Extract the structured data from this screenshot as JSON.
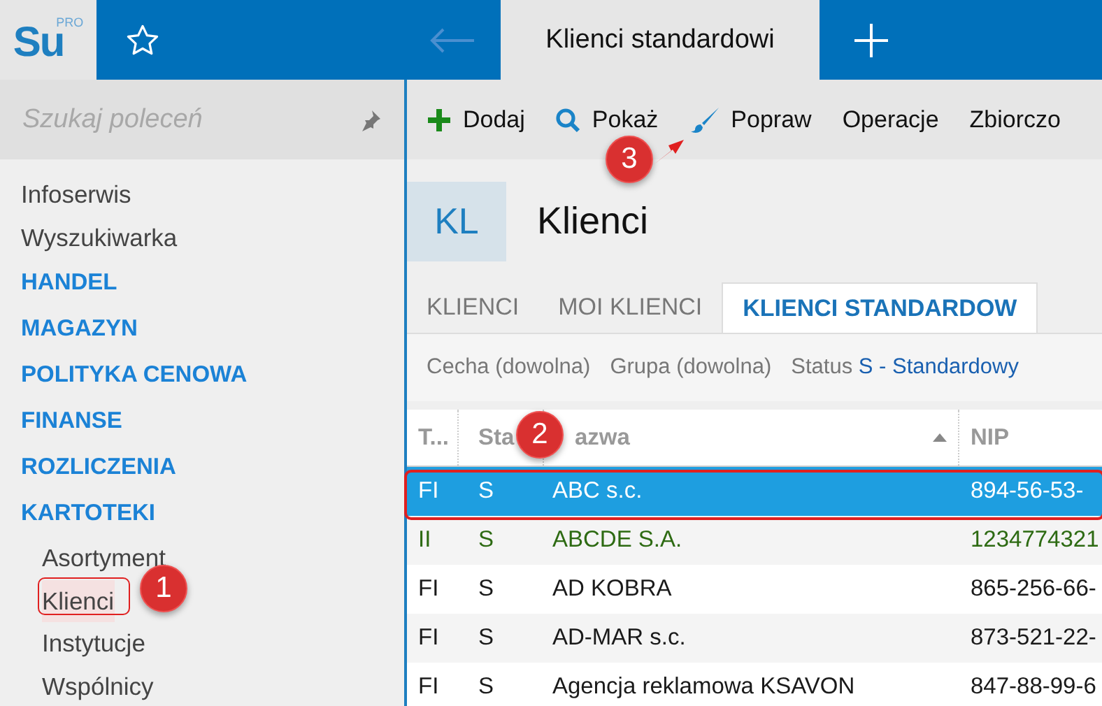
{
  "app": {
    "logo": "Su",
    "logo_badge": "PRO"
  },
  "tabs": [
    {
      "label": "Klienci standardowi",
      "selected": true
    }
  ],
  "sidebar": {
    "search": {
      "placeholder": "Szukaj poleceń"
    },
    "items": [
      {
        "kind": "link",
        "label": "Infoserwis",
        "selected": false
      },
      {
        "kind": "link",
        "label": "Wyszukiwarka",
        "selected": false
      },
      {
        "kind": "section",
        "label": "HANDEL",
        "selected": false
      },
      {
        "kind": "section",
        "label": "MAGAZYN",
        "selected": false
      },
      {
        "kind": "section",
        "label": "POLITYKA CENOWA",
        "selected": false
      },
      {
        "kind": "section",
        "label": "FINANSE",
        "selected": false
      },
      {
        "kind": "section",
        "label": "ROZLICZENIA",
        "selected": false
      },
      {
        "kind": "section",
        "label": "KARTOTEKI",
        "selected": false,
        "children": [
          {
            "label": "Asortyment",
            "selected": false
          },
          {
            "label": "Klienci",
            "selected": true
          },
          {
            "label": "Instytucje",
            "selected": false
          },
          {
            "label": "Wspólnicy",
            "selected": false
          }
        ]
      }
    ]
  },
  "toolbar": [
    {
      "kind": "add",
      "label": "Dodaj"
    },
    {
      "kind": "search",
      "label": "Pokaż"
    },
    {
      "kind": "brush",
      "label": "Popraw"
    },
    {
      "kind": "plain",
      "label": "Operacje"
    },
    {
      "kind": "plain",
      "label": "Zbiorczo"
    }
  ],
  "header": {
    "badge": "KL",
    "title": "Klienci"
  },
  "view_tabs": [
    {
      "label": "KLIENCI",
      "selected": false
    },
    {
      "label": "MOI KLIENCI",
      "selected": false
    },
    {
      "label": "KLIENCI STANDARDOW",
      "selected": true
    }
  ],
  "filters": [
    {
      "label": "Cecha (dowolna)"
    },
    {
      "label": "Grupa (dowolna)"
    },
    {
      "label": "Status",
      "value": "S - Standardowy"
    }
  ],
  "table": {
    "columns": [
      {
        "label": "T..."
      },
      {
        "label": "Sta"
      },
      {
        "label": "azwa",
        "sorted": true
      },
      {
        "label": "NIP"
      }
    ],
    "rows": [
      {
        "cells": [
          "FI",
          "S",
          "ABC s.c.",
          "894-56-53-"
        ],
        "selected": true
      },
      {
        "cells": [
          "II",
          "S",
          "ABCDE S.A.",
          "1234774321"
        ],
        "selected": false,
        "color": "#2d6a12"
      },
      {
        "cells": [
          "FI",
          "S",
          "AD KOBRA",
          "865-256-66-"
        ],
        "selected": false,
        "color": "#1a1a1a"
      },
      {
        "cells": [
          "FI",
          "S",
          "AD-MAR s.c.",
          "873-521-22-"
        ],
        "selected": false,
        "color": "#1a1a1a"
      },
      {
        "cells": [
          "FI",
          "S",
          "Agencja reklamowa KSAVON",
          "847-88-99-6"
        ],
        "selected": false,
        "color": "#1a1a1a"
      }
    ]
  },
  "callouts": [
    {
      "number": "1"
    },
    {
      "number": "2"
    },
    {
      "number": "3"
    }
  ]
}
